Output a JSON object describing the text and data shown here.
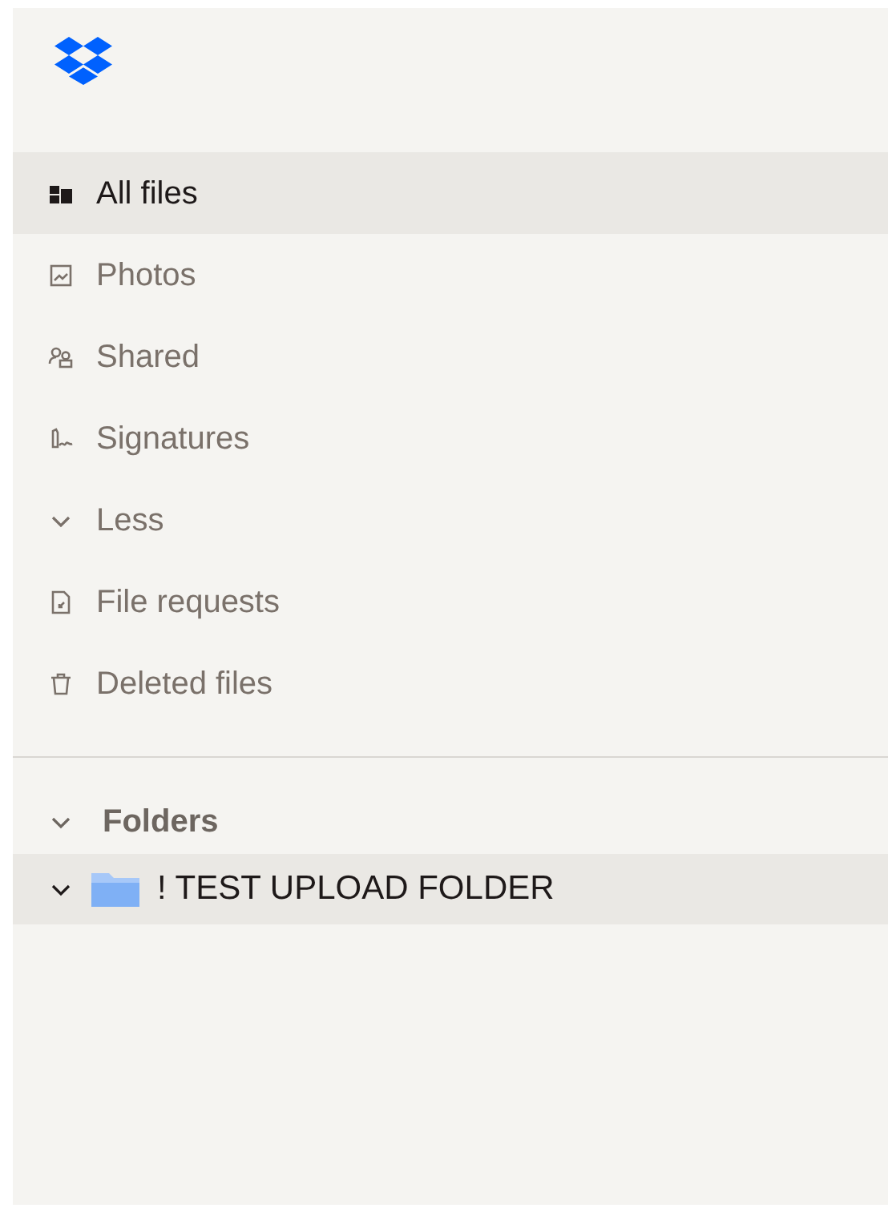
{
  "nav": {
    "items": [
      {
        "label": "All files",
        "kind": "link",
        "selected": true
      },
      {
        "label": "Photos",
        "kind": "link",
        "selected": false
      },
      {
        "label": "Shared",
        "kind": "link",
        "selected": false
      },
      {
        "label": "Signatures",
        "kind": "link",
        "selected": false
      },
      {
        "label": "Less",
        "kind": "toggle",
        "selected": false
      },
      {
        "label": "File requests",
        "kind": "link",
        "selected": false
      },
      {
        "label": "Deleted files",
        "kind": "link",
        "selected": false
      }
    ]
  },
  "folders": {
    "title": "Folders",
    "expanded": true,
    "items": [
      {
        "label": "! TEST UPLOAD FOLDER",
        "selected": true,
        "expanded": true
      }
    ]
  }
}
